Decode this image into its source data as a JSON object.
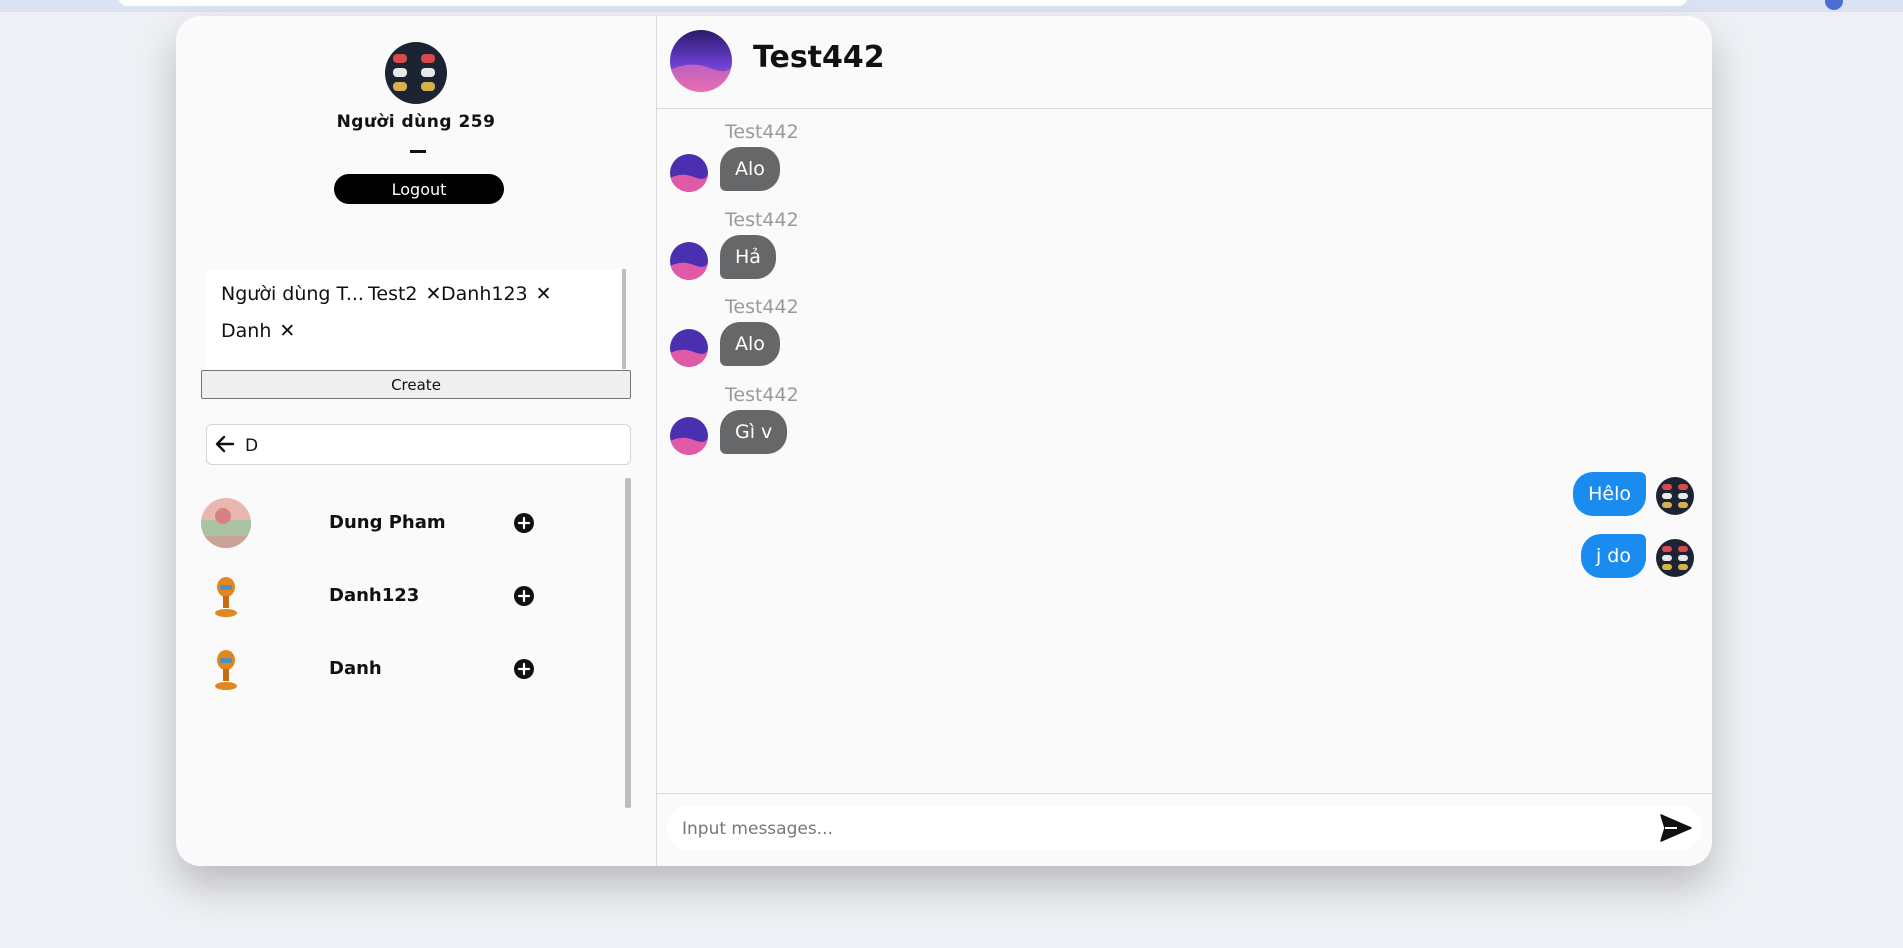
{
  "profile": {
    "name": "Người dùng 259",
    "logout_label": "Logout"
  },
  "group": {
    "chips": [
      {
        "label": "Người dùng T..."
      },
      {
        "label": "Test2"
      },
      {
        "label": "Danh123"
      },
      {
        "label": "Danh"
      }
    ],
    "remove_glyph": "✕",
    "create_label": "Create"
  },
  "search": {
    "value": "D"
  },
  "results": [
    {
      "name": "Dung Pham"
    },
    {
      "name": "Danh123"
    },
    {
      "name": "Danh"
    }
  ],
  "chat": {
    "title": "Test442",
    "incoming": [
      {
        "sender": "Test442",
        "text": "Alo"
      },
      {
        "sender": "Test442",
        "text": "Hả"
      },
      {
        "sender": "Test442",
        "text": "Alo"
      },
      {
        "sender": "Test442",
        "text": "Gì v"
      }
    ],
    "outgoing": [
      {
        "text": "Hêlo"
      },
      {
        "text": "j do"
      }
    ]
  },
  "composer": {
    "placeholder": "Input messages..."
  },
  "colors": {
    "incoming_bubble": "#666769",
    "outgoing_bubble": "#1a8cf0",
    "logout_bg": "#000000"
  }
}
